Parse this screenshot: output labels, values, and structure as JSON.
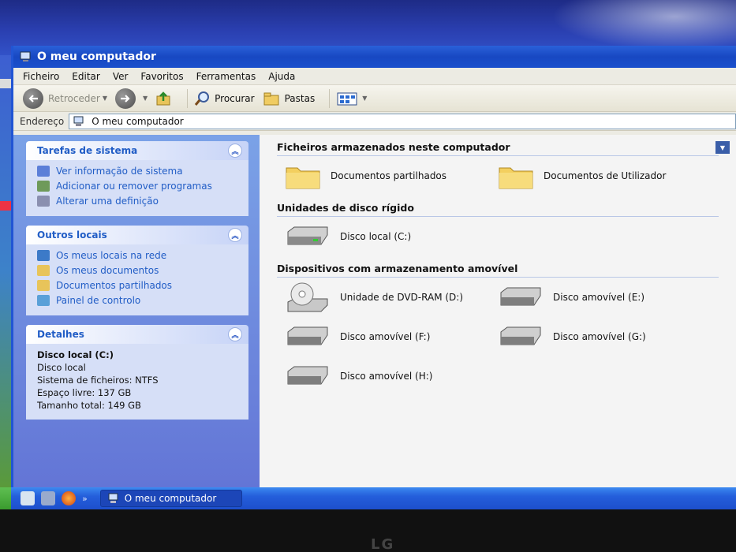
{
  "window": {
    "title": "O meu computador"
  },
  "menu": [
    "Ficheiro",
    "Editar",
    "Ver",
    "Favoritos",
    "Ferramentas",
    "Ajuda"
  ],
  "toolbar": {
    "back_label": "Retroceder",
    "search_label": "Procurar",
    "folders_label": "Pastas"
  },
  "address": {
    "label": "Endereço",
    "value": "O meu computador"
  },
  "left_pane": {
    "system_tasks": {
      "title": "Tarefas de sistema",
      "links": [
        "Ver informação de sistema",
        "Adicionar ou remover programas",
        "Alterar uma definição"
      ]
    },
    "other_places": {
      "title": "Outros locais",
      "links": [
        "Os meus locais na rede",
        "Os meus documentos",
        "Documentos partilhados",
        "Painel de controlo"
      ]
    },
    "details": {
      "title": "Detalhes",
      "name": "Disco local (C:)",
      "type": "Disco local",
      "filesystem": "Sistema de ficheiros: NTFS",
      "free": "Espaço livre: 137 GB",
      "total": "Tamanho total: 149 GB"
    }
  },
  "groups": {
    "stored_files": {
      "title": "Ficheiros armazenados neste computador",
      "items": [
        "Documentos partilhados",
        "Documentos de Utilizador"
      ]
    },
    "hard_disks": {
      "title": "Unidades de disco rígido",
      "items": [
        "Disco local (C:)"
      ]
    },
    "removable": {
      "title": "Dispositivos com armazenamento amovível",
      "items": [
        "Unidade de DVD-RAM (D:)",
        "Disco amovível (E:)",
        "Disco amovível (F:)",
        "Disco amovível (G:)",
        "Disco amovível (H:)"
      ]
    }
  },
  "taskbar": {
    "task_label": "O meu computador"
  },
  "bezel": {
    "logo": "LG"
  }
}
